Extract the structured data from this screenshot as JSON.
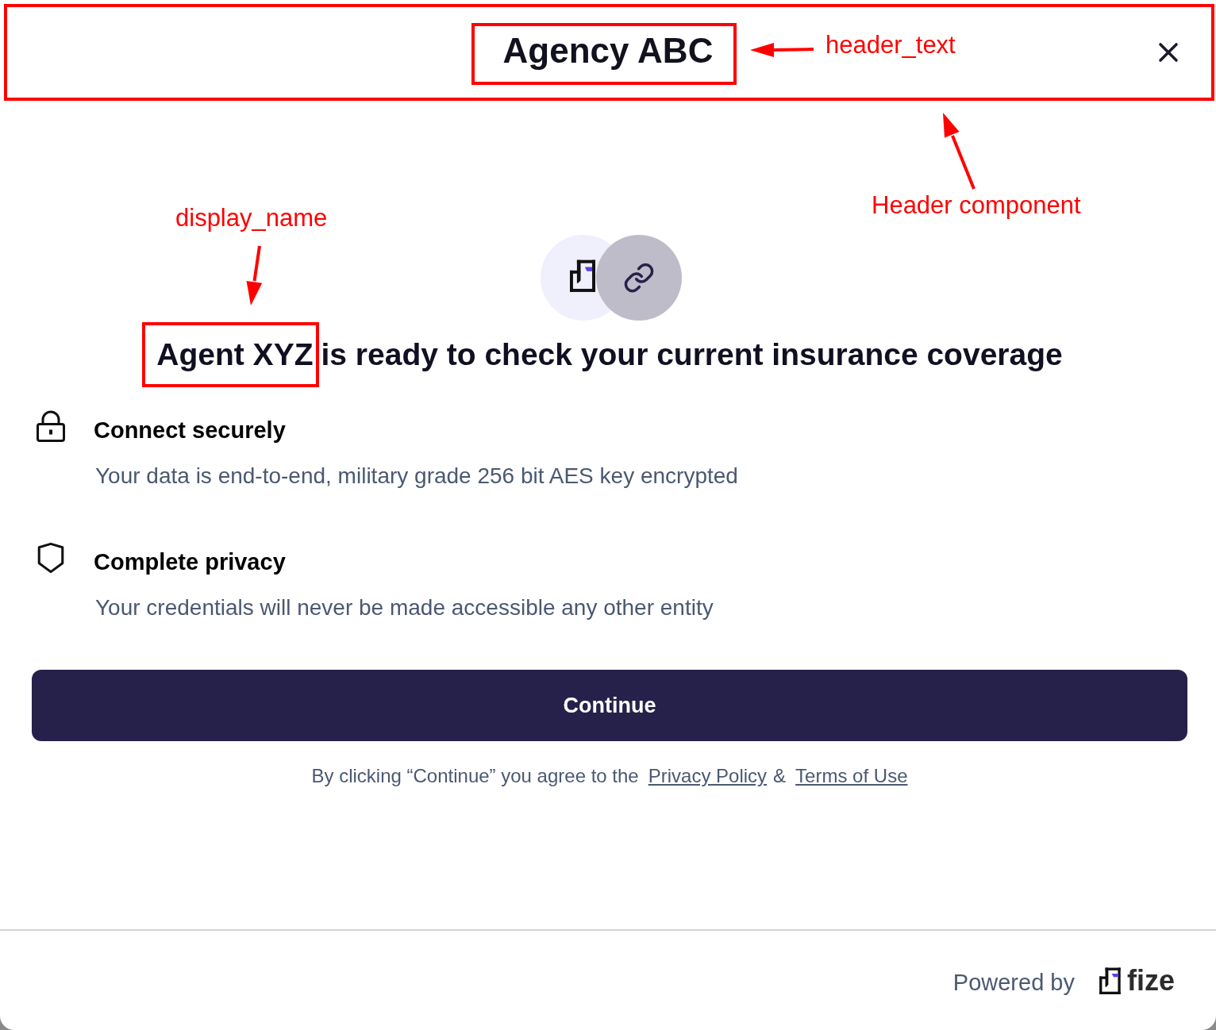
{
  "header": {
    "title": "Agency ABC",
    "highlighted": true,
    "title_highlighted": true
  },
  "headline": {
    "display_name": "Agent XYZ",
    "display_name_highlighted": true,
    "text": "is ready to check your current insurance coverage"
  },
  "features": [
    {
      "kind": "security",
      "title": "Connect securely",
      "description": "Your data is end-to-end, military grade 256 bit AES key encrypted"
    },
    {
      "kind": "privacy",
      "title": "Complete privacy",
      "description": "Your credentials will never be made accessible any other entity"
    }
  ],
  "continue_button": {
    "label": "Continue"
  },
  "consent": {
    "text": "By clicking “Continue” you agree to the",
    "links": [
      {
        "label": "Privacy Policy"
      },
      {
        "label": "Terms of Use"
      }
    ],
    "separator": "&"
  },
  "footer": {
    "powered_by": "Powered by",
    "brand": "fize"
  },
  "annotations": [
    {
      "label": "header_text"
    },
    {
      "label": "Header component"
    },
    {
      "label": "display_name"
    }
  ]
}
